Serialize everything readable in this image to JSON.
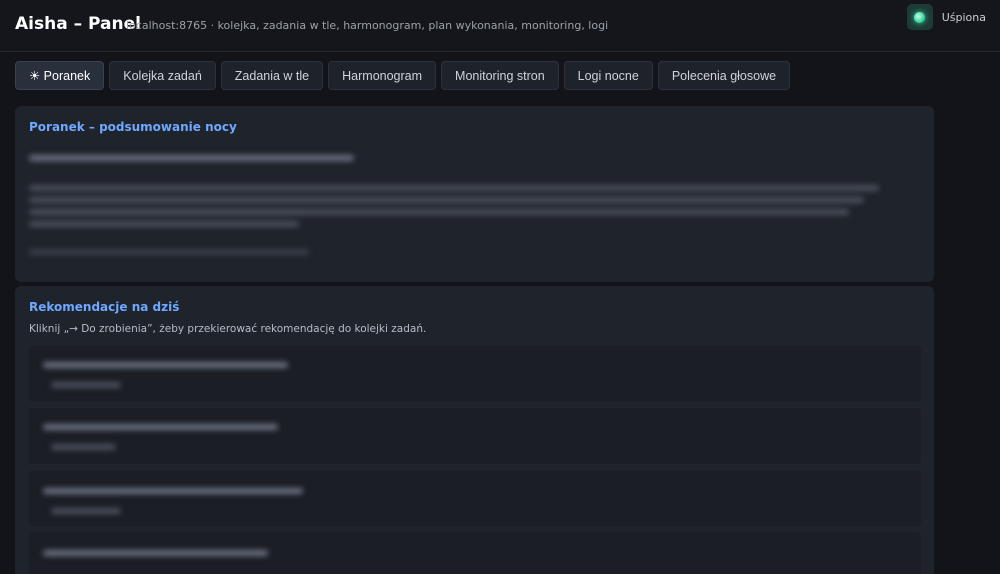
{
  "app": {
    "title": "Aisha – Panel",
    "subtitle": "localhost:8765 · kolejka, zadania w tle, harmonogram, plan wykonania, monitoring, logi",
    "status_label": "Uśpiona"
  },
  "tabs": [
    {
      "label": "☀ Poranek",
      "active": true
    },
    {
      "label": "Kolejka zadań"
    },
    {
      "label": "Zadania w tle"
    },
    {
      "label": "Harmonogram"
    },
    {
      "label": "Monitoring stron"
    },
    {
      "label": "Logi nocne"
    },
    {
      "label": "Polecenia głosowe"
    }
  ],
  "summary": {
    "title": "Poranek – podsumowanie nocy"
  },
  "recommendations": {
    "title": "Rekomendacje na dziś",
    "hint": "Kliknij „→ Do zrobienia”, żeby przekierować rekomendację do kolejki zadań."
  },
  "colors": {
    "accent": "#6ea8ff",
    "status": "#35d79b",
    "background": "#121419",
    "card": "#1f232b"
  }
}
